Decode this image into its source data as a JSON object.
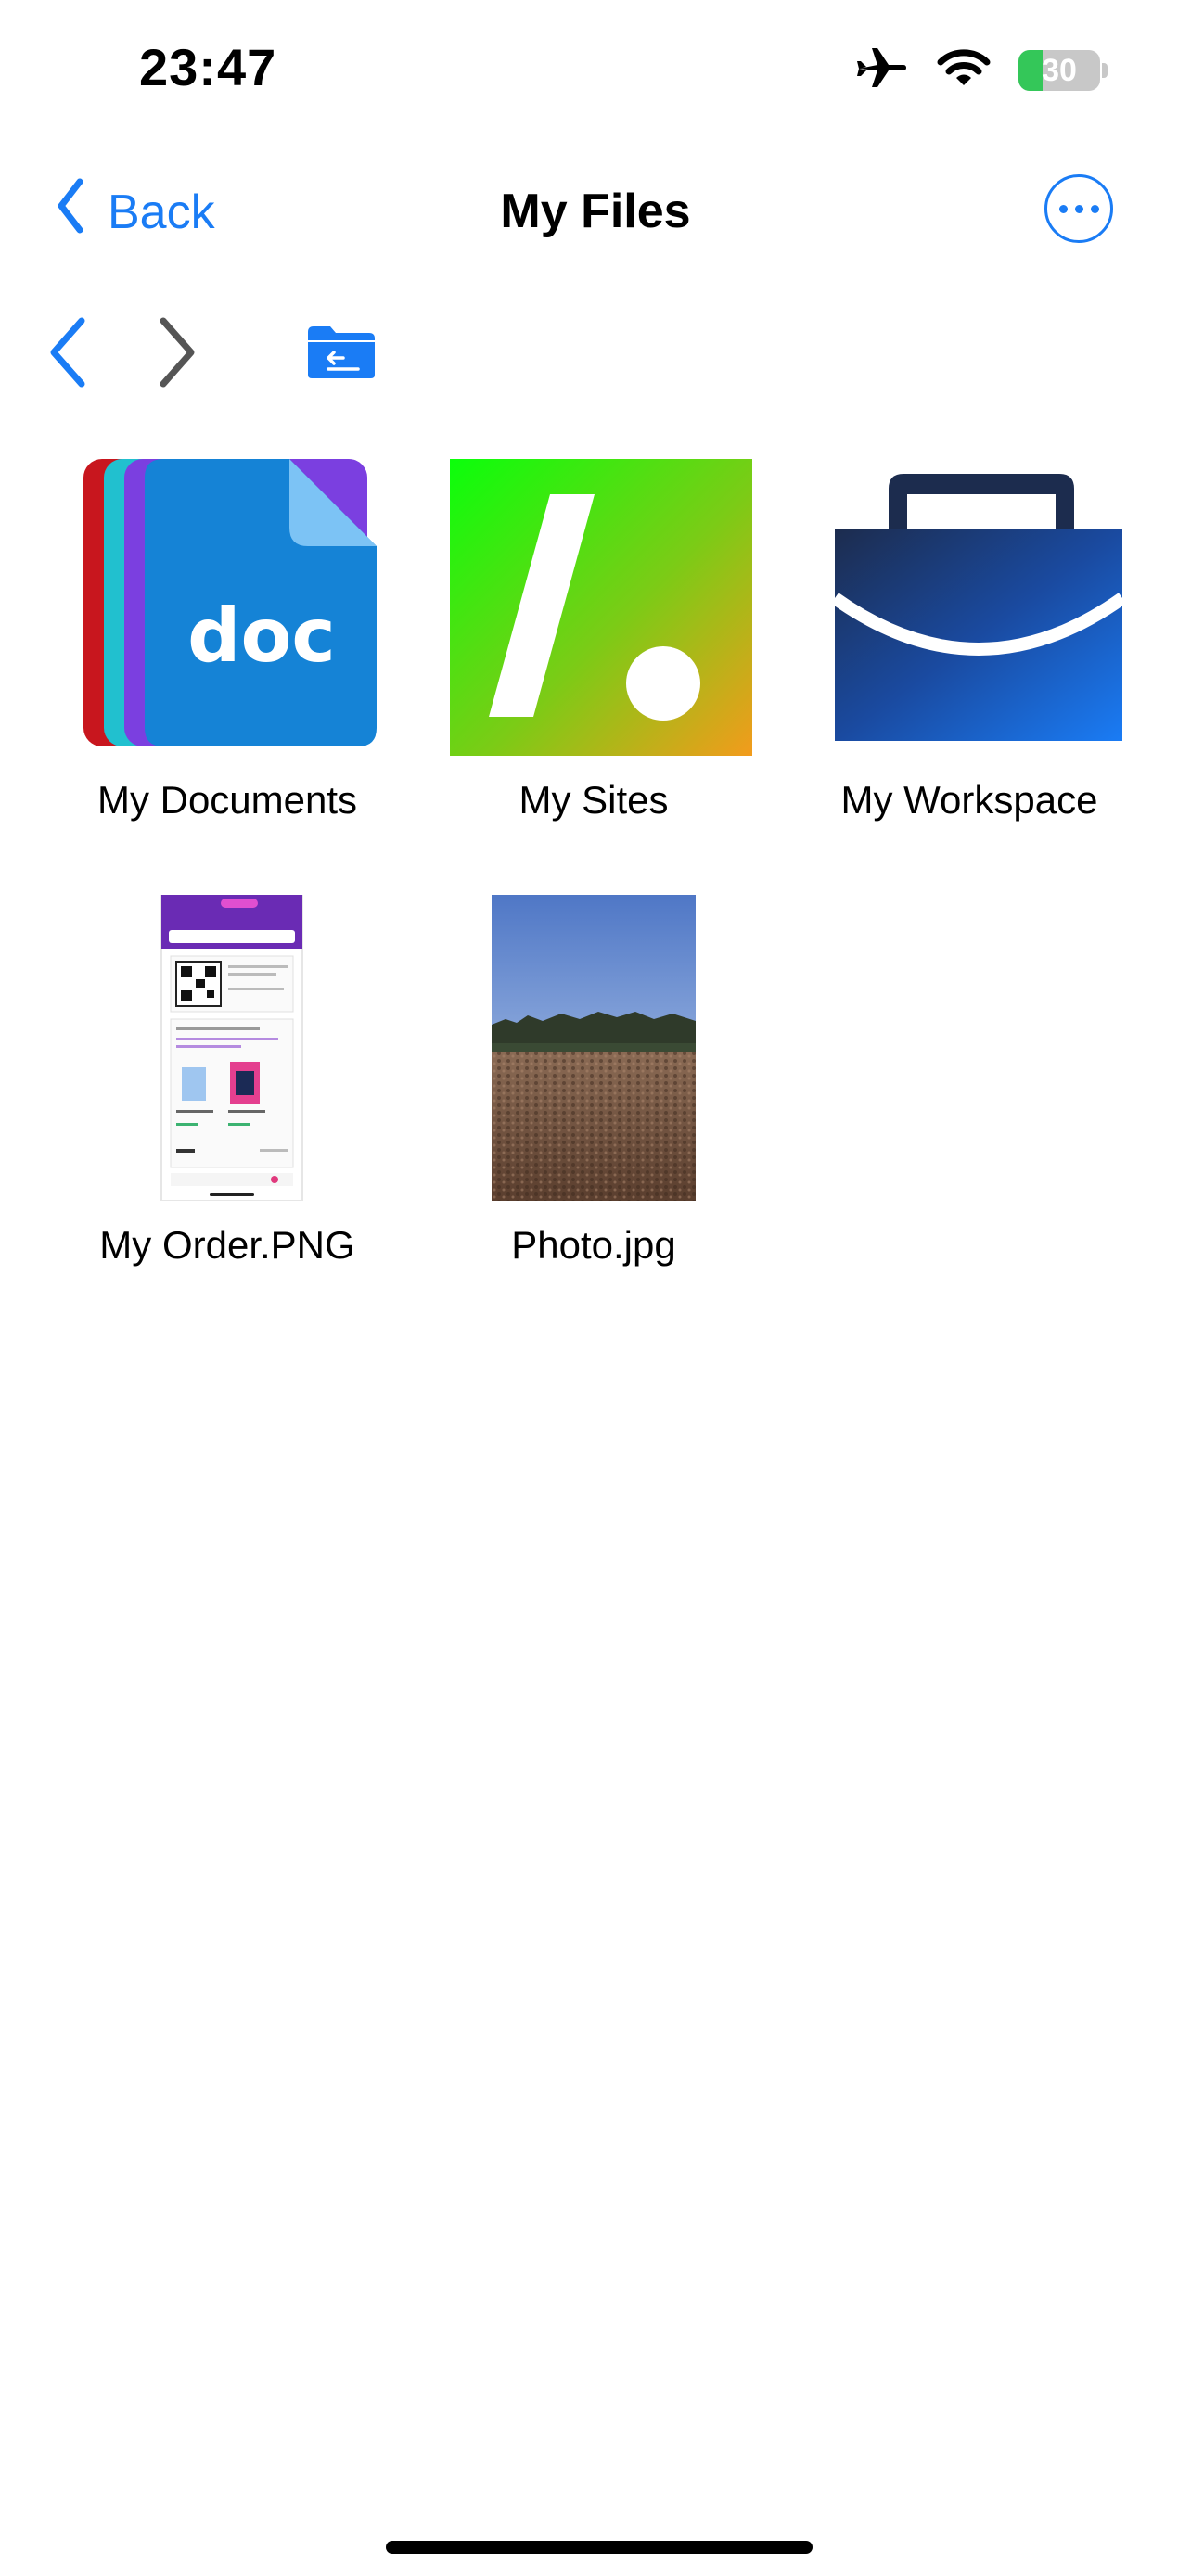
{
  "status_bar": {
    "time": "23:47",
    "battery_level": "30",
    "battery_fraction": 0.3,
    "icons": [
      "airplane-icon",
      "wifi-icon",
      "battery-charging-icon"
    ]
  },
  "nav": {
    "back_label": "Back",
    "title": "My Files",
    "more_icon": "ellipsis-circle-icon"
  },
  "toolbar": {
    "items": [
      "chevron-left-icon",
      "chevron-right-icon",
      "folder-upload-icon"
    ]
  },
  "files": [
    {
      "label": "My Documents",
      "icon": "doc-stack-icon",
      "icon_text": "doc"
    },
    {
      "label": "My Sites",
      "icon": "sites-icon"
    },
    {
      "label": "My Workspace",
      "icon": "briefcase-icon"
    },
    {
      "label": "My Order.PNG",
      "icon": "image-thumbnail"
    },
    {
      "label": "Photo.jpg",
      "icon": "photo-thumbnail"
    }
  ],
  "colors": {
    "accent": "#1a7cf5",
    "battery_green": "#34c759"
  }
}
